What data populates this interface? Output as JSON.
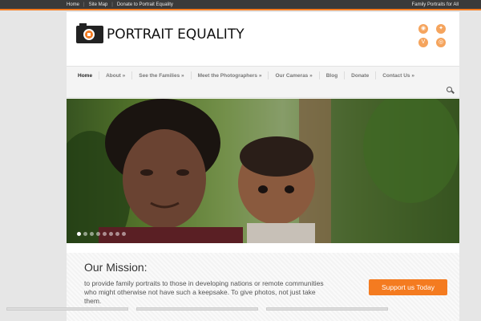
{
  "topbar": {
    "links": [
      "Home",
      "Site Map",
      "Donate to Portrait Equality"
    ],
    "tagline": "Family Portraits for All"
  },
  "header": {
    "logo_text": "PORTRAIT EQUALITY",
    "social_icons": [
      "rss-icon",
      "twitter-icon",
      "vimeo-icon",
      "instagram-icon"
    ]
  },
  "nav": {
    "items": [
      {
        "label": "Home"
      },
      {
        "label": "About »"
      },
      {
        "label": "See the Families »"
      },
      {
        "label": "Meet the Photographers »"
      },
      {
        "label": "Our Cameras »"
      },
      {
        "label": "Blog"
      },
      {
        "label": "Donate"
      },
      {
        "label": "Contact Us »"
      }
    ],
    "active_index": 0
  },
  "slider": {
    "slide_count": 8,
    "active_slide": 1
  },
  "mission": {
    "title": "Our Mission:",
    "text": "to provide family portraits to those in developing nations or remote communities who might otherwise not have such a keepsake. To give photos, not just take them.",
    "button_label": "Support us Today"
  },
  "colors": {
    "accent": "#f47b20",
    "topbar": "#3a3a3a",
    "social": "#f5a45d"
  }
}
